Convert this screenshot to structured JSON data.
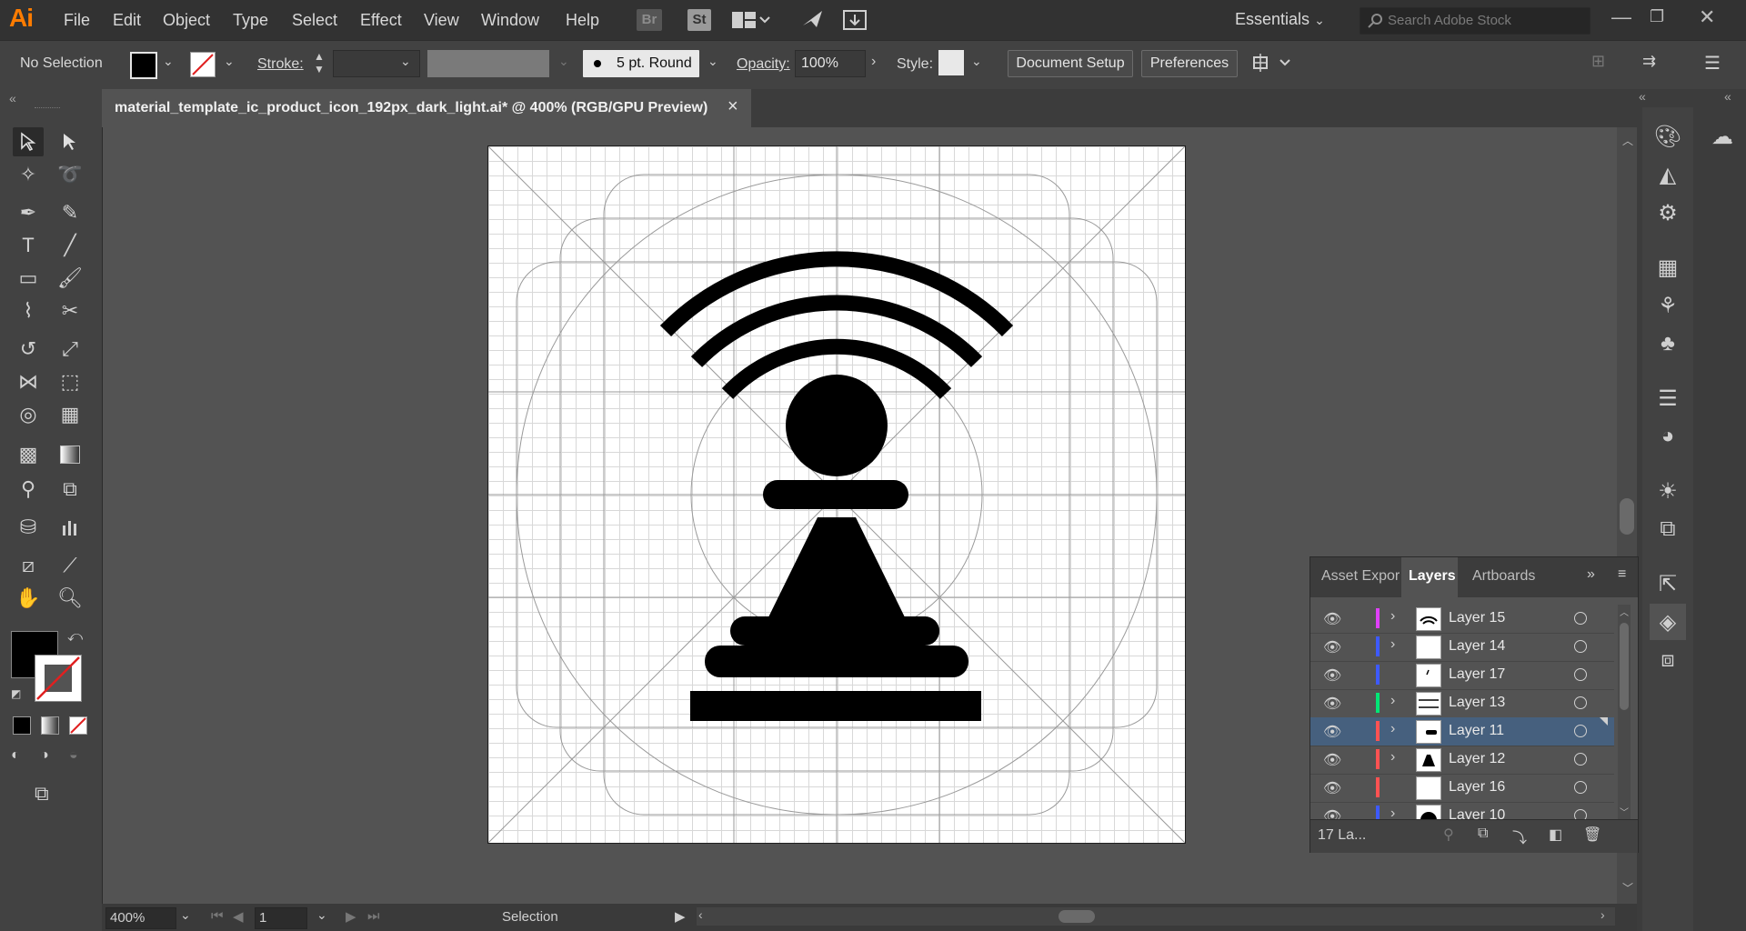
{
  "app": {
    "logo": "Ai"
  },
  "menu": {
    "items": [
      "File",
      "Edit",
      "Object",
      "Type",
      "Select",
      "Effect",
      "View",
      "Window",
      "Help"
    ],
    "bridge_label": "Br",
    "stock_label": "St"
  },
  "workspace": {
    "label": "Essentials"
  },
  "search": {
    "placeholder": "Search Adobe Stock"
  },
  "control": {
    "selection_status": "No Selection",
    "stroke_label": "Stroke:",
    "brush_label": "5 pt. Round",
    "opacity_label": "Opacity:",
    "opacity_value": "100%",
    "style_label": "Style:",
    "document_setup": "Document Setup",
    "preferences": "Preferences"
  },
  "document": {
    "title": "material_template_ic_product_icon_192px_dark_light.ai* @ 400% (RGB/GPU Preview)",
    "close_glyph": "×"
  },
  "layers_panel": {
    "tabs": [
      "Asset Expor",
      "Layers",
      "Artboards"
    ],
    "active_tab": "Layers",
    "rows": [
      {
        "name": "Layer 15",
        "color": "#e040fb",
        "expandable": true,
        "selected": false
      },
      {
        "name": "Layer 14",
        "color": "#3d5afe",
        "expandable": true,
        "selected": false
      },
      {
        "name": "Layer 17",
        "color": "#3d5afe",
        "expandable": false,
        "selected": false
      },
      {
        "name": "Layer 13",
        "color": "#00e676",
        "expandable": true,
        "selected": false
      },
      {
        "name": "Layer 11",
        "color": "#ff5252",
        "expandable": true,
        "selected": true
      },
      {
        "name": "Layer 12",
        "color": "#ff5252",
        "expandable": true,
        "selected": false
      },
      {
        "name": "Layer 16",
        "color": "#ff5252",
        "expandable": false,
        "selected": false
      }
    ],
    "partial_row": "Layer 10",
    "count_label": "17 La..."
  },
  "status": {
    "zoom": "400%",
    "artboard_number": "1",
    "tool_name": "Selection"
  },
  "colors": {
    "accent": "#ff7c00",
    "selection_row": "#46607e",
    "fill": "#000000"
  }
}
